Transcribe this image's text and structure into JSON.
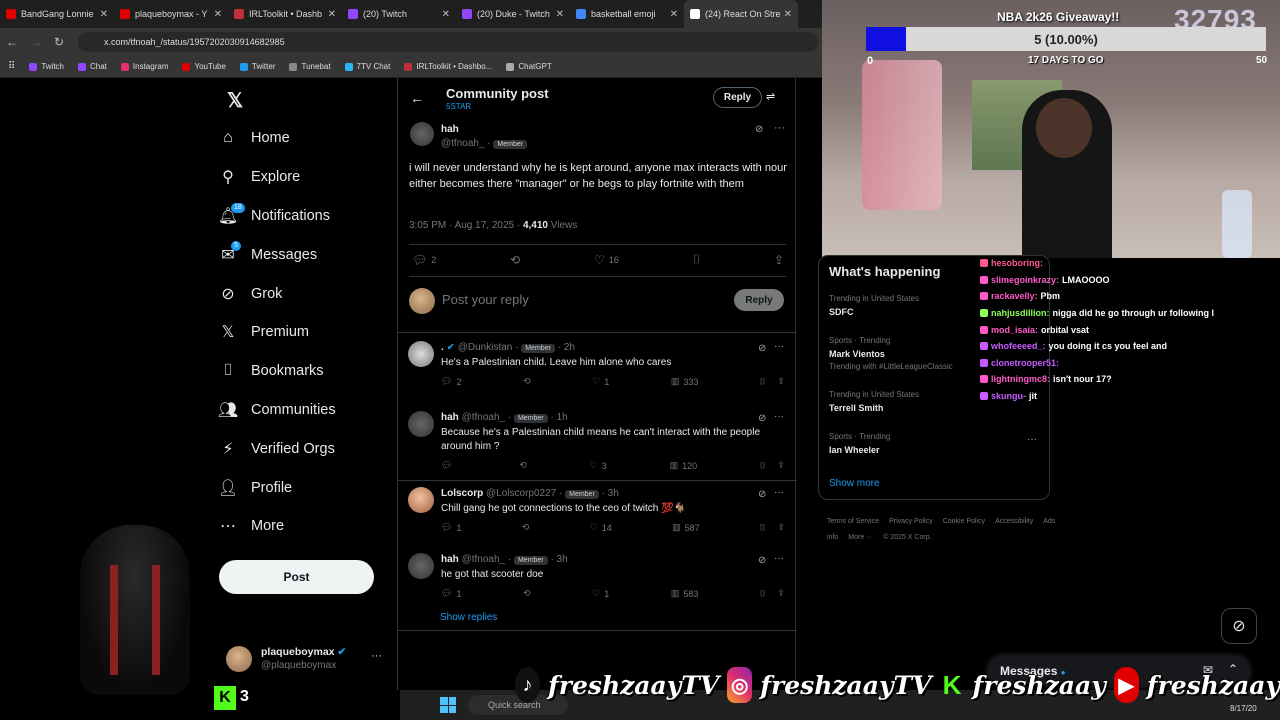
{
  "browser": {
    "tabs": [
      {
        "label": "BandGang Lonnie",
        "color": "#e00000"
      },
      {
        "label": "plaqueboymax - Y",
        "color": "#e00000"
      },
      {
        "label": "IRLToolkit • Dashb",
        "color": "#c0303a"
      },
      {
        "label": "(20) Twitch",
        "color": "#9146ff"
      },
      {
        "label": "(20) Duke - Twitch",
        "color": "#9146ff"
      },
      {
        "label": "basketball emoji",
        "color": "#4285f4"
      },
      {
        "label": "(24) React On Stre",
        "color": "#ffffff"
      }
    ],
    "url": "x.com/tfnoah_/status/1957202030914682985",
    "bookmarks": [
      {
        "label": "Twitch",
        "color": "#9146ff"
      },
      {
        "label": "Chat",
        "color": "#9146ff"
      },
      {
        "label": "Instagram",
        "color": "#e1306c"
      },
      {
        "label": "YouTube",
        "color": "#e00000"
      },
      {
        "label": "Twitter",
        "color": "#1d9bf0"
      },
      {
        "label": "Tunebat",
        "color": "#888888"
      },
      {
        "label": "7TV Chat",
        "color": "#29b6f6"
      },
      {
        "label": "IRLToolkit • Dashbo...",
        "color": "#c0303a"
      },
      {
        "label": "ChatGPT",
        "color": "#aaaaaa"
      }
    ]
  },
  "sidebar": {
    "logo": "𝕏",
    "items": [
      {
        "label": "Home",
        "icon": "home-icon",
        "glyph": "⌂"
      },
      {
        "label": "Explore",
        "icon": "search-icon",
        "glyph": "⚲"
      },
      {
        "label": "Notifications",
        "icon": "bell-icon",
        "glyph": "🔔︎",
        "badge": "18"
      },
      {
        "label": "Messages",
        "icon": "envelope-icon",
        "glyph": "✉",
        "badge": "5"
      },
      {
        "label": "Grok",
        "icon": "grok-icon",
        "glyph": "⊘"
      },
      {
        "label": "Premium",
        "icon": "x-icon",
        "glyph": "𝕏"
      },
      {
        "label": "Bookmarks",
        "icon": "bookmark-icon",
        "glyph": "⌷"
      },
      {
        "label": "Communities",
        "icon": "communities-icon",
        "glyph": "👥︎"
      },
      {
        "label": "Verified Orgs",
        "icon": "lightning-icon",
        "glyph": "⚡︎"
      },
      {
        "label": "Profile",
        "icon": "person-icon",
        "glyph": "👤︎"
      },
      {
        "label": "More",
        "icon": "more-circle-icon",
        "glyph": "⋯"
      }
    ],
    "post_label": "Post",
    "account": {
      "name": "plaqueboymax",
      "handle": "@plaqueboymax",
      "menu": "···"
    }
  },
  "post": {
    "header_title": "Community post",
    "header_sub": "5STAR",
    "reply_button": "Reply",
    "author": "hah",
    "handle": "@tfnoah_",
    "member": "Member",
    "text": "i will never understand why he is kept around, anyone max interacts with nour either becomes there \"manager\" or he begs to play fortnite with them",
    "time": "3:05 PM · Aug 17, 2025 ·",
    "views_count": "4,410",
    "views_label": "Views",
    "replies": "2",
    "likes": "16",
    "compose_placeholder": "Post your reply",
    "compose_button": "Reply"
  },
  "replies": [
    {
      "name": ".",
      "handle": "@Dunkistan · ",
      "member": "Member",
      "time": "· 2h",
      "text": "He's a Palestinian child. Leave him alone who cares",
      "replies": "2",
      "retweets": "",
      "likes": "1",
      "views": "333",
      "verified": true
    },
    {
      "name": "hah",
      "handle": "@tfnoah_ · ",
      "member": "Member",
      "time": "· 1h",
      "text": "Because he's a Palestinian child means he can't interact with the people around him ?",
      "replies": "",
      "retweets": "",
      "likes": "3",
      "views": "120",
      "verified": false
    },
    {
      "name": "Lolscorp",
      "handle": "@Lolscorp0227 · ",
      "member": "Member",
      "time": "· 3h",
      "text": "Chill gang he got connections to the ceo of twitch 💯🐐",
      "replies": "1",
      "retweets": "",
      "likes": "14",
      "views": "587",
      "verified": false
    },
    {
      "name": "hah",
      "handle": "@tfnoah_ · ",
      "member": "Member",
      "time": "· 3h",
      "text": "he got that scooter doe",
      "replies": "1",
      "retweets": "",
      "likes": "1",
      "views": "583",
      "verified": false
    }
  ],
  "show_replies": "Show replies",
  "trends": {
    "title": "What's happening",
    "items": [
      {
        "context": "Trending in United States",
        "name": "SDFC",
        "extra": ""
      },
      {
        "context": "Sports · Trending",
        "name": "Mark Vientos",
        "extra": "Trending with #LittleLeagueClassic"
      },
      {
        "context": "Trending in United States",
        "name": "Terrell Smith",
        "extra": ""
      },
      {
        "context": "Sports · Trending",
        "name": "Ian Wheeler",
        "extra": ""
      }
    ],
    "show_more": "Show more",
    "footer": [
      "Terms of Service",
      "Privacy Policy",
      "Cookie Policy",
      "Accessibility",
      "Ads info",
      "More ···",
      "© 2025 X Corp."
    ]
  },
  "overlay": {
    "giveaway_title": "NBA 2k26 Giveaway!!",
    "counter": "32793",
    "progress_text": "5 (10.00%)",
    "progress_fraction": 0.1,
    "min": "0",
    "max": "50",
    "days_left": "17 DAYS TO GO",
    "kick_count": "3",
    "banner_text": "freshzaayTV",
    "banner_text_short": "freshzaay",
    "messages_label": "Messages"
  },
  "chat": [
    {
      "user": "hesoboring:",
      "msg": "",
      "color": "#ff5a8c"
    },
    {
      "user": "slimegoinkrazy:",
      "msg": "LMAOOOO",
      "color": "#ff5ac8"
    },
    {
      "user": "rackavelly:",
      "msg": "Pbm",
      "color": "#ff5ac8"
    },
    {
      "user": "nahjusdillion:",
      "msg": "nigga did he go through ur following l",
      "color": "#8cff5a"
    },
    {
      "user": "mod_isaia:",
      "msg": "orbital vsat",
      "color": "#ff5ac8"
    },
    {
      "user": "whofeeeed_:",
      "msg": "you doing it cs you feel and",
      "color": "#c85aff"
    },
    {
      "user": "clonetrooper51:",
      "msg": "",
      "color": "#c85aff"
    },
    {
      "user": "lightningmc8:",
      "msg": "isn't nour 17?",
      "color": "#ff5ac8"
    },
    {
      "user": "skungu-",
      "msg": "jit",
      "color": "#c85aff"
    }
  ],
  "taskbar": {
    "search_placeholder": "Quick search",
    "date": "8/17/20"
  }
}
